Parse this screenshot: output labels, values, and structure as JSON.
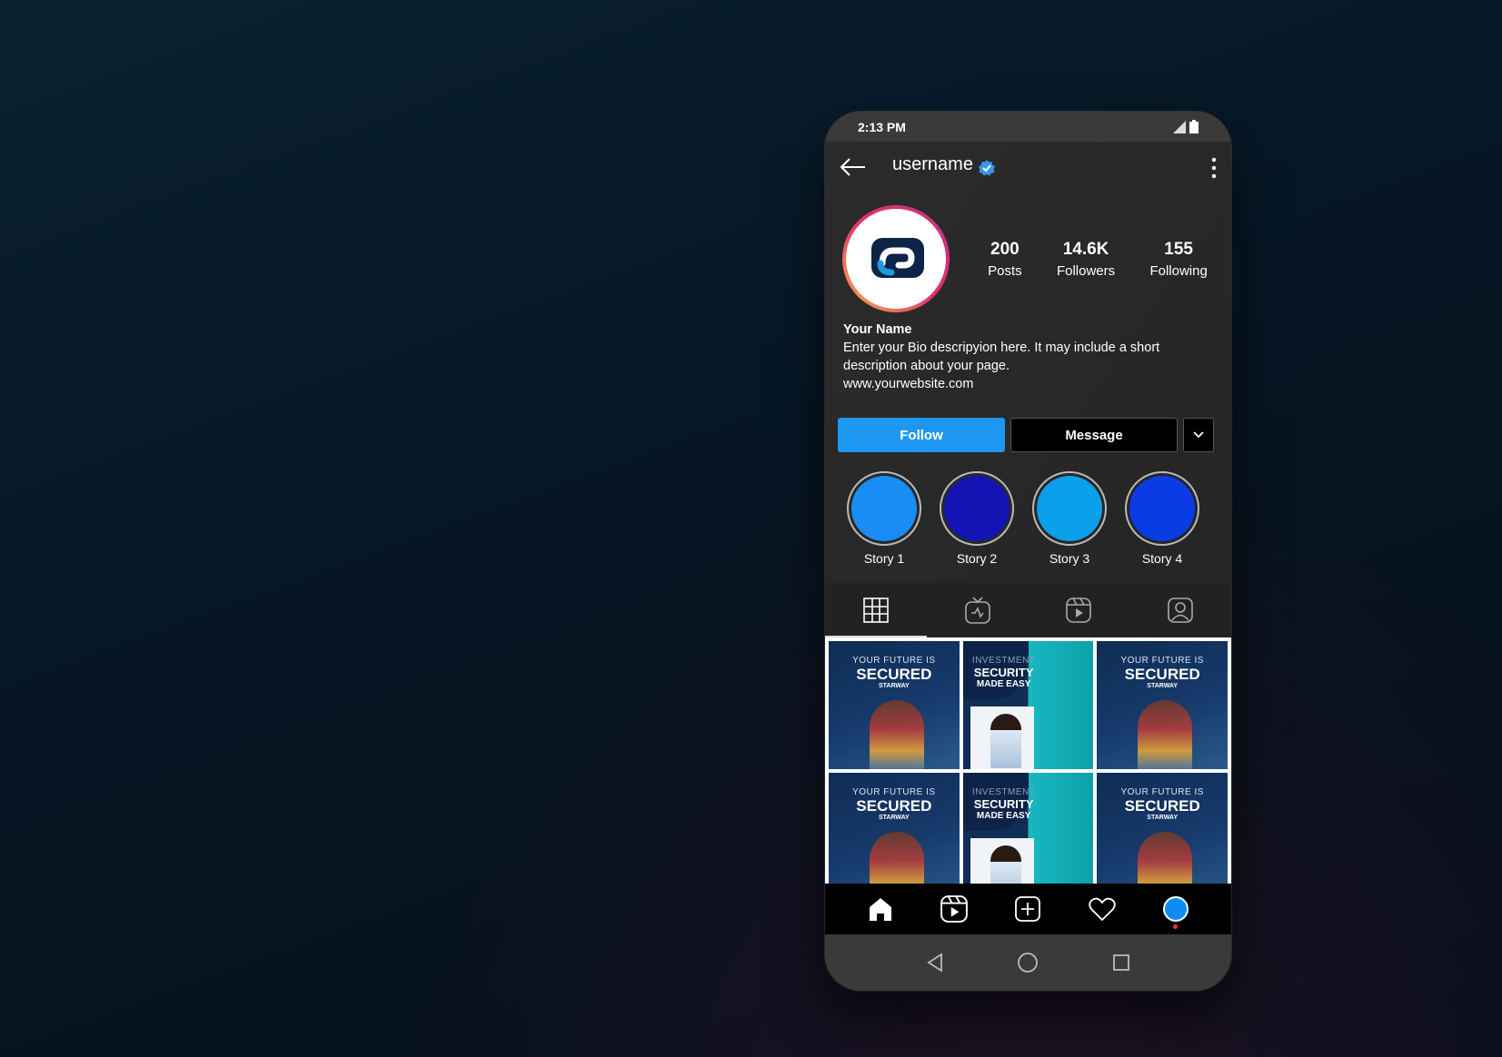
{
  "status_bar": {
    "time": "2:13 PM"
  },
  "header": {
    "username": "username",
    "back_icon": "arrow-left-icon",
    "verified_icon": "verified-badge-icon",
    "menu_icon": "more-vertical-icon"
  },
  "profile": {
    "stats": [
      {
        "value": "200",
        "label": "Posts"
      },
      {
        "value": "14.6K",
        "label": "Followers"
      },
      {
        "value": "155",
        "label": "Following"
      }
    ],
    "name": "Your Name",
    "bio_line1": "Enter your Bio descripyion here. It may include a short",
    "bio_line2": "description about your page.",
    "website": "www.yourwebsite.com"
  },
  "buttons": {
    "follow": "Follow",
    "message": "Message"
  },
  "stories": [
    {
      "label": "Story 1",
      "color": "#1a8cf5"
    },
    {
      "label": "Story 2",
      "color": "#1414b4"
    },
    {
      "label": "Story 3",
      "color": "#0aa0ec"
    },
    {
      "label": "Story 4",
      "color": "#0a3ce6"
    }
  ],
  "tabs": [
    "grid-icon",
    "igtv-icon",
    "reels-icon",
    "tagged-icon"
  ],
  "posts": [
    {
      "kind": "a",
      "line1": "YOUR FUTURE IS",
      "line2": "SECURED",
      "line3": "STARWAY"
    },
    {
      "kind": "b",
      "line1": "INVESTMENT",
      "line2": "SECURITY",
      "line3": "MADE EASY"
    },
    {
      "kind": "a",
      "line1": "YOUR FUTURE IS",
      "line2": "SECURED",
      "line3": "STARWAY"
    },
    {
      "kind": "a",
      "line1": "YOUR FUTURE IS",
      "line2": "SECURED",
      "line3": "STARWAY"
    },
    {
      "kind": "b",
      "line1": "INVESTMENT",
      "line2": "SECURITY",
      "line3": "MADE EASY"
    },
    {
      "kind": "a",
      "line1": "YOUR FUTURE IS",
      "line2": "SECURED",
      "line3": "STARWAY"
    }
  ],
  "bottom_nav": [
    "home-icon",
    "reels-icon",
    "add-post-icon",
    "heart-icon",
    "profile-avatar"
  ],
  "colors": {
    "accent": "#1e97f3",
    "background": "#262626"
  }
}
